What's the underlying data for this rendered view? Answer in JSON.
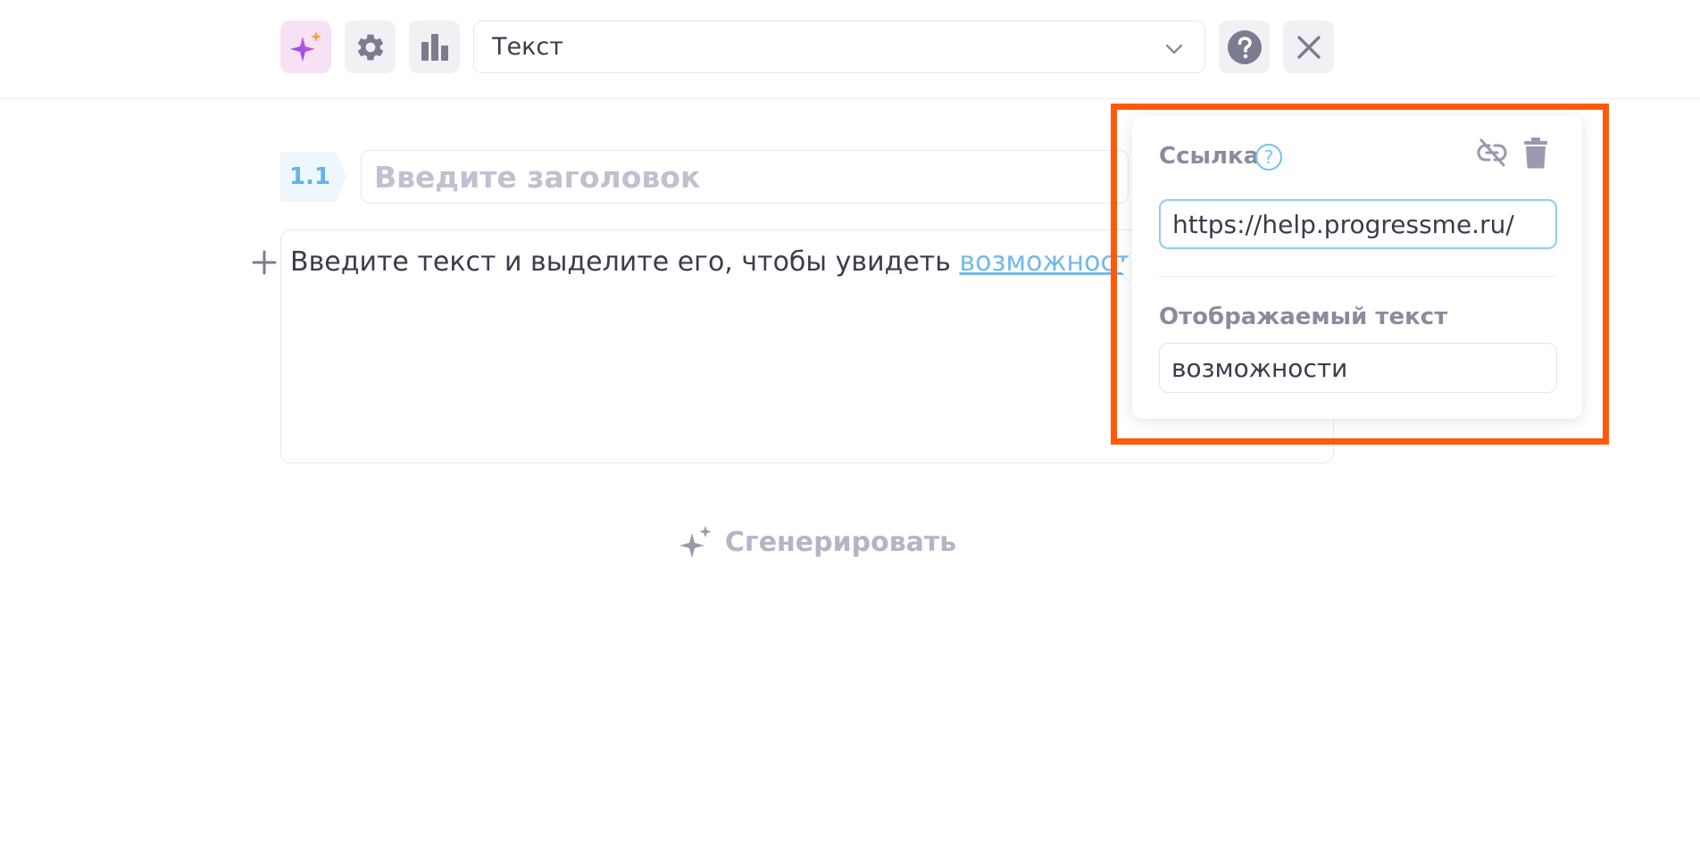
{
  "toolbar": {
    "ai_icon": "sparkle-icon",
    "settings_icon": "gear-icon",
    "stats_icon": "bar-chart-icon",
    "type_select_value": "Текст",
    "help_icon": "question-circle-icon",
    "close_icon": "close-icon"
  },
  "section": {
    "number": "1.1",
    "title_placeholder": "Введите заголовок"
  },
  "text_block": {
    "text_before_link": "Введите текст и выделите его, чтобы увидеть ",
    "link_text": "возможности",
    "text_after_link": "."
  },
  "generate": {
    "label": "Сгенерировать"
  },
  "link_popover": {
    "url_label": "Ссылка",
    "help_glyph": "?",
    "url_value": "https://help.progressme.ru/",
    "display_text_label": "Отображаемый текст",
    "display_text_value": "возможности",
    "unlink_icon": "unlink-icon",
    "delete_icon": "trash-icon"
  },
  "colors": {
    "accent": "#74c2ee",
    "link": "#73b8ea",
    "highlight": "#ff5a0a",
    "muted": "#b4b4c6"
  }
}
